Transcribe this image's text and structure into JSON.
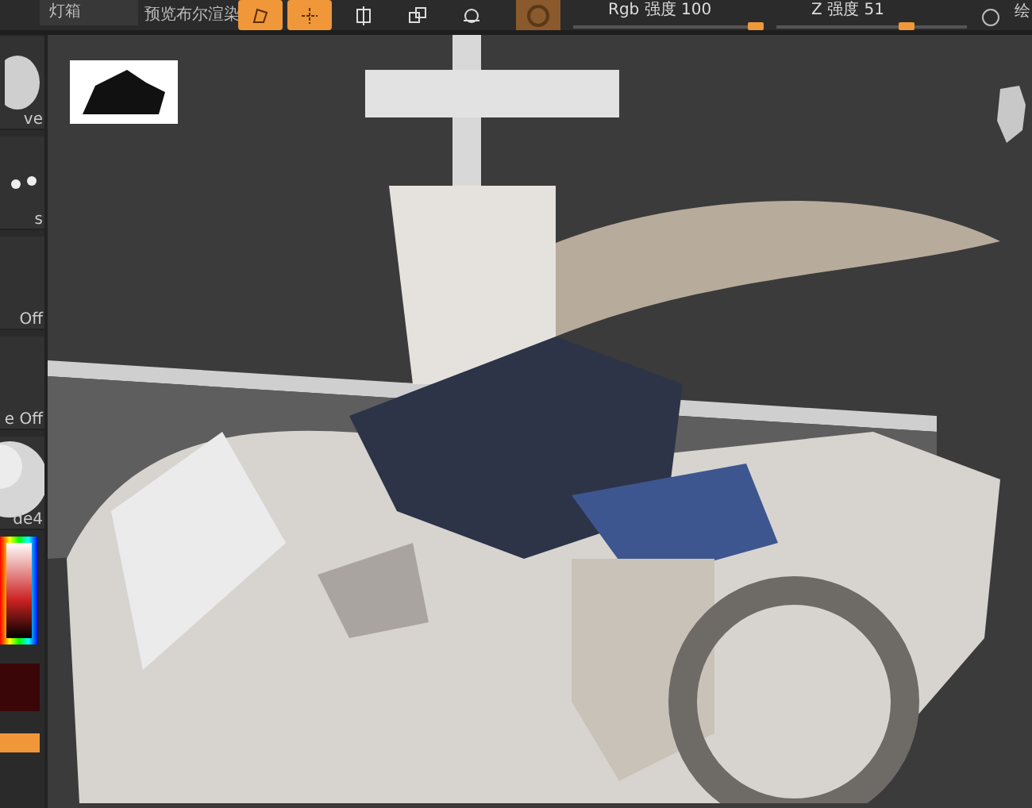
{
  "toolbar": {
    "lightbox_button": "灯箱",
    "preview_label": "预览布尔渲染",
    "tools": [
      {
        "kind": "edit",
        "selected": true
      },
      {
        "kind": "draw",
        "selected": true
      },
      {
        "kind": "move",
        "selected": false
      },
      {
        "kind": "scale",
        "selected": false
      },
      {
        "kind": "rotate",
        "selected": false
      }
    ],
    "material_toggle": {
      "on": true
    },
    "sliders": [
      {
        "label": "Rgb 强度 100",
        "level": 1.0
      },
      {
        "label": "Z 强度 51",
        "level": 0.7
      }
    ],
    "cut_label": "绘"
  },
  "left_panel": {
    "tiles": [
      {
        "kind": "brush",
        "caption": "ve"
      },
      {
        "kind": "stroke",
        "caption": "s"
      },
      {
        "kind": "alpha",
        "caption": "Off"
      },
      {
        "kind": "texture",
        "caption": "e Off"
      },
      {
        "kind": "material",
        "caption": "de4"
      }
    ]
  }
}
